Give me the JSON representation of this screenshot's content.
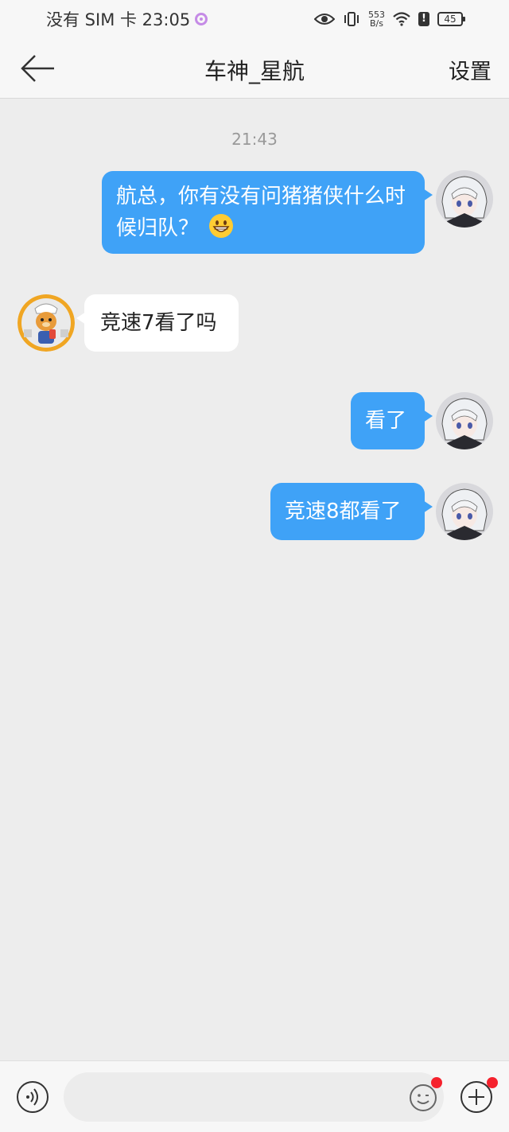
{
  "status_bar": {
    "carrier_time": "没有 SIM 卡 23:05",
    "net_speed_value": "553",
    "net_speed_unit": "B/s",
    "alert": "!",
    "battery": "45"
  },
  "header": {
    "title": "车神_星航",
    "settings_label": "设置"
  },
  "chat": {
    "timestamp": "21:43",
    "messages": [
      {
        "direction": "out",
        "text": "航总，你有没有问猪猪侠什么时候归队？",
        "emoji": "grinning-face"
      },
      {
        "direction": "in",
        "text": "竞速7看了吗"
      },
      {
        "direction": "out",
        "text": "看了"
      },
      {
        "direction": "out",
        "text": "竞速8都看了"
      }
    ]
  },
  "input_bar": {
    "placeholder": ""
  },
  "colors": {
    "outgoing_bubble": "#3fa2f7",
    "incoming_bubble": "#ffffff",
    "background": "#ededed",
    "badge": "#f5222d"
  }
}
